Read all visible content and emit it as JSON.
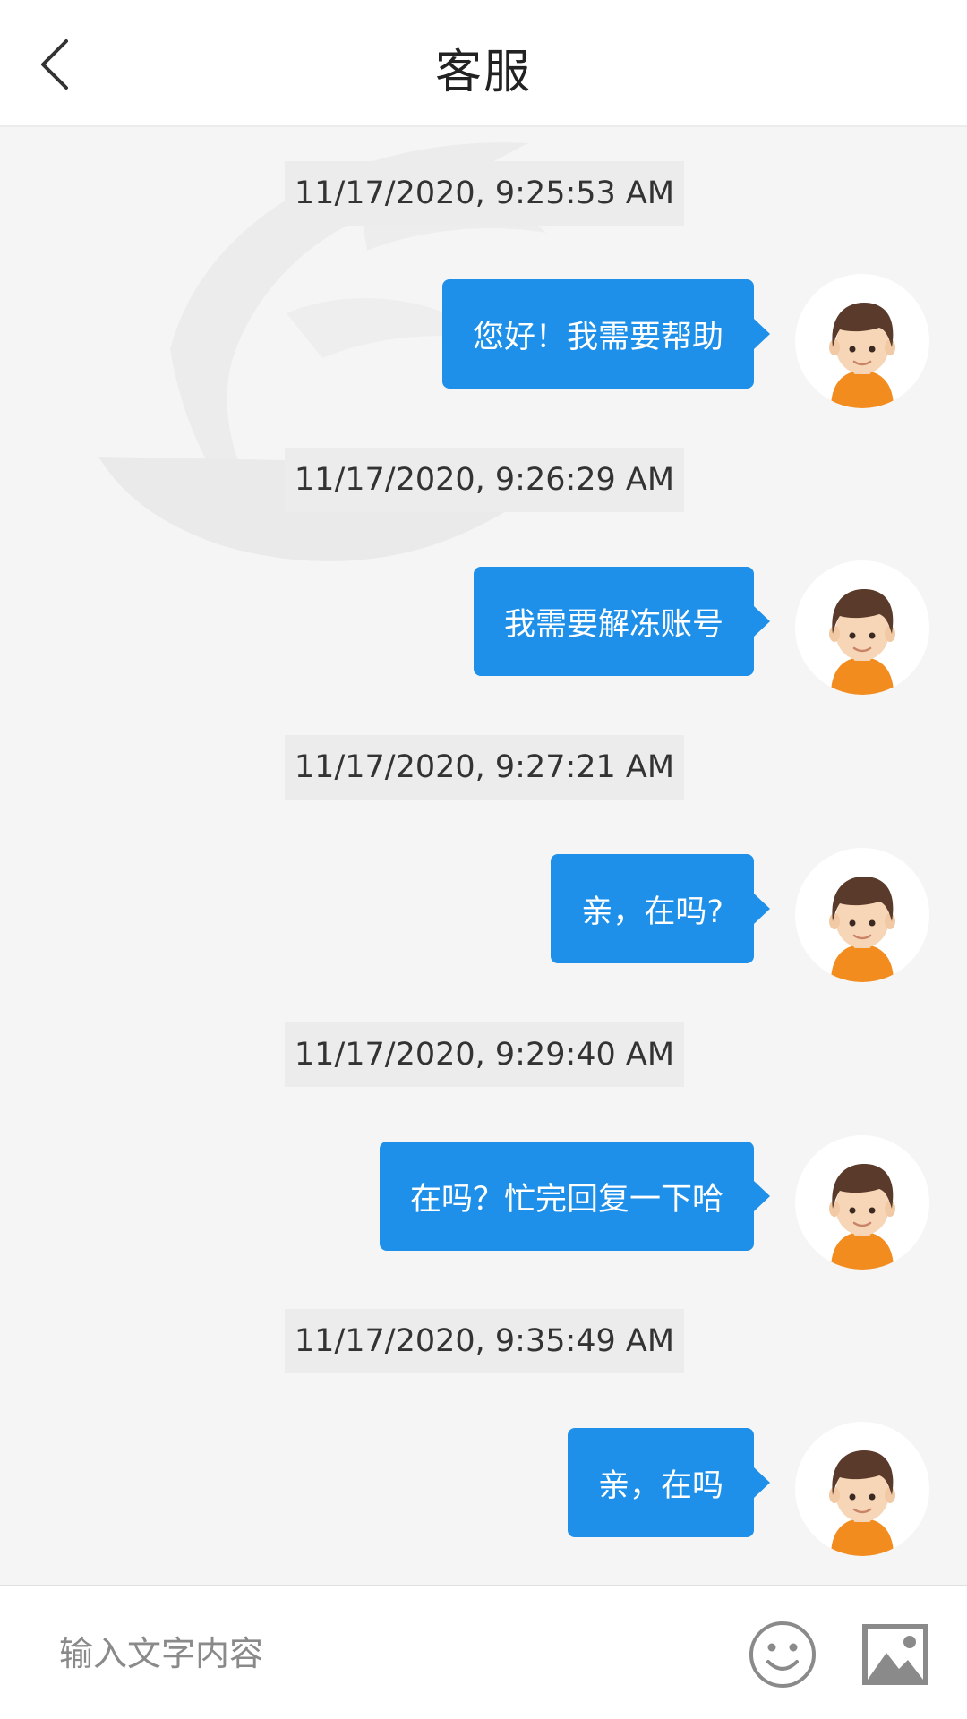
{
  "header": {
    "title": "客服",
    "back_icon": "back-chevron-icon"
  },
  "messages": [
    {
      "timestamp": "11/17/2020, 9:25:53 AM",
      "text": "您好！我需要帮助"
    },
    {
      "timestamp": "11/17/2020, 9:26:29 AM",
      "text": "我需要解冻账号"
    },
    {
      "timestamp": "11/17/2020, 9:27:21 AM",
      "text": "亲，在吗?"
    },
    {
      "timestamp": "11/17/2020, 9:29:40 AM",
      "text": "在吗？忙完回复一下哈"
    },
    {
      "timestamp": "11/17/2020, 9:35:49 AM",
      "text": "亲，在吗"
    }
  ],
  "input_bar": {
    "placeholder": "输入文字内容",
    "emoji_icon": "smiley-icon",
    "image_icon": "image-icon"
  },
  "colors": {
    "bubble": "#1e90ea",
    "background": "#f5f5f5",
    "timestamp_bg": "#ececec"
  }
}
